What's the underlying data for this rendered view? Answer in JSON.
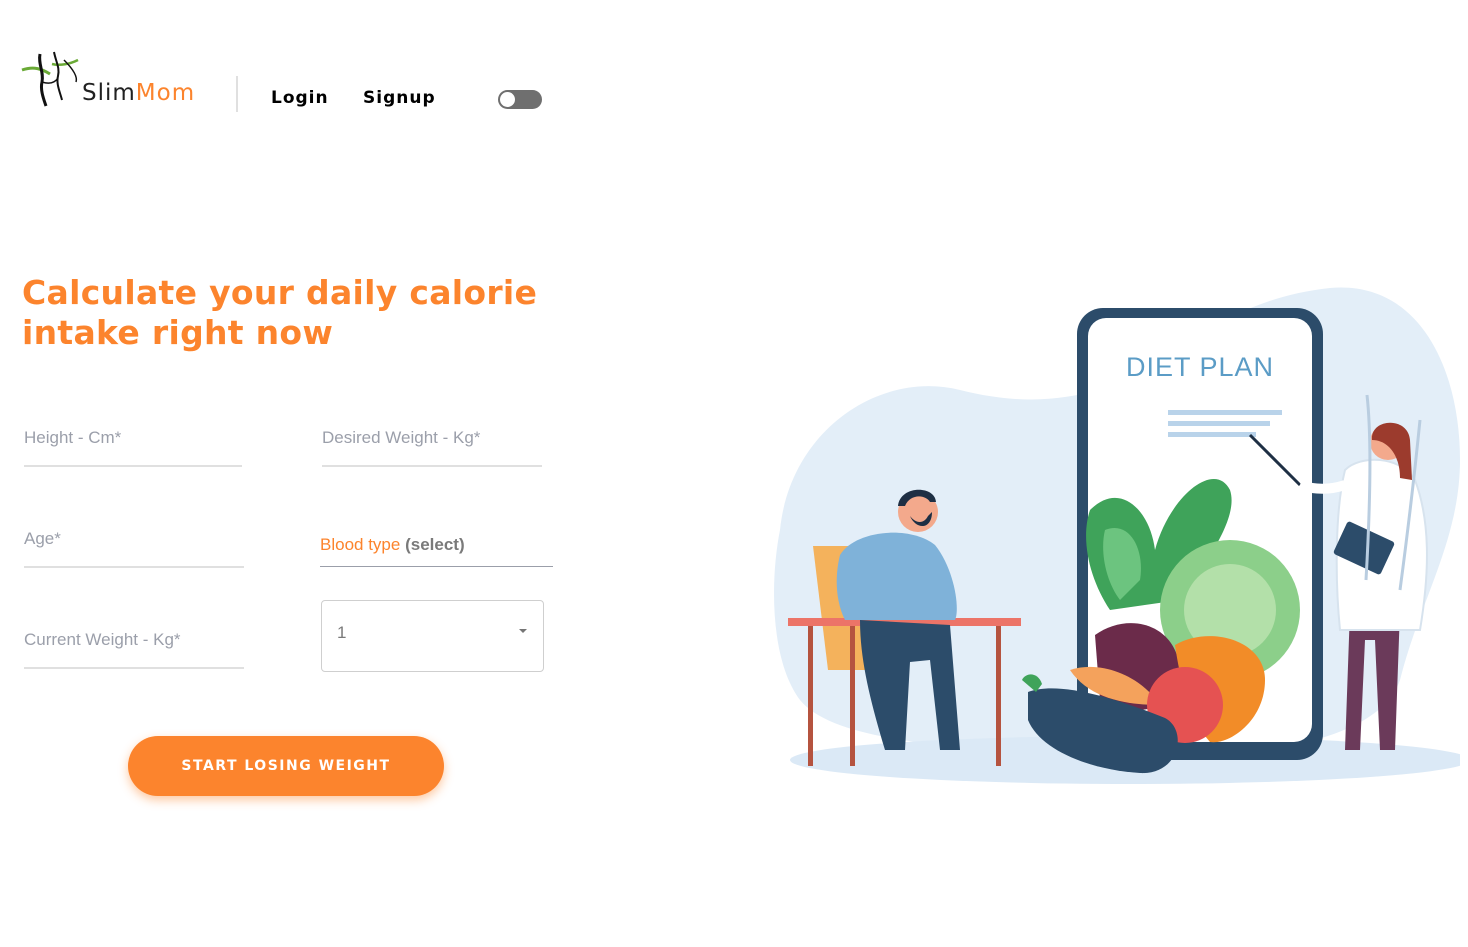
{
  "header": {
    "logo": {
      "part1": "Slim",
      "part2": "Mom"
    },
    "nav": {
      "login": "Login",
      "signup": "Signup"
    }
  },
  "main": {
    "title": "Calculate your daily calorie intake right now",
    "form": {
      "height_placeholder": "Height - Cm*",
      "desired_weight_placeholder": "Desired Weight - Kg*",
      "age_placeholder": "Age*",
      "current_weight_placeholder": "Current Weight - Kg*",
      "blood_type_label": "Blood type",
      "blood_type_hint": "(select)",
      "blood_type_value": "1",
      "submit_label": "START LOSING WEIGHT"
    }
  },
  "illustration": {
    "phone_title": "DIET PLAN"
  },
  "colors": {
    "accent": "#fc842d",
    "toggle_track": "#6f6f6f",
    "diet_title": "#5b9cc6"
  },
  "icons": {
    "logo": "slimmom-logo-figure",
    "select_arrow": "caret-down-icon",
    "theme_toggle": "toggle-switch"
  }
}
